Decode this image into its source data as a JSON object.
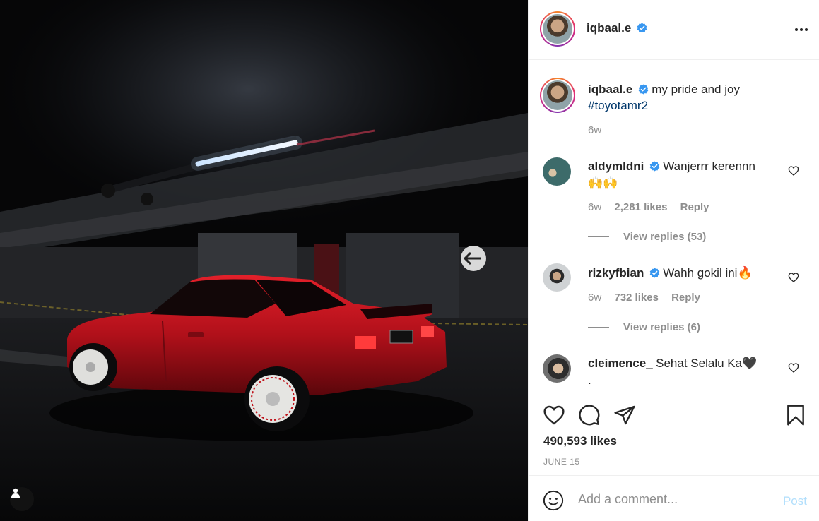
{
  "post": {
    "author": "iqbaal.e",
    "caption_text": "my pride and joy",
    "caption_hashtag": "#toyotamr2",
    "caption_age": "6w",
    "likes": "490,593 likes",
    "date": "JUNE 15"
  },
  "comments": [
    {
      "username": "aldymldni",
      "verified": true,
      "text": "Wanjerrr kerennn",
      "text_line2": "🙌🙌",
      "age": "6w",
      "likes": "2,281 likes",
      "reply_label": "Reply",
      "view_replies": "View replies (53)"
    },
    {
      "username": "rizkyfbian",
      "verified": true,
      "text": "Wahh gokil ini🔥",
      "age": "6w",
      "likes": "732 likes",
      "reply_label": "Reply",
      "view_replies": "View replies (6)"
    },
    {
      "username": "cleimence_",
      "verified": false,
      "text": "Sehat Selalu Ka🖤",
      "text_line2": "."
    }
  ],
  "add_comment": {
    "placeholder": "Add a comment...",
    "post_label": "Post"
  },
  "icons": {
    "verified": "verified-badge-icon",
    "like": "heart-icon",
    "comment": "comment-bubble-icon",
    "share": "paper-plane-icon",
    "save": "bookmark-icon",
    "emoji": "smiley-icon",
    "more": "more-options-icon",
    "tag": "user-tag-icon"
  },
  "colors": {
    "verified_blue": "#3897f0",
    "hashtag": "#00376b",
    "muted": "#8e8e8e",
    "post_disabled": "#b2dffc",
    "car_red": "#c8101c"
  }
}
